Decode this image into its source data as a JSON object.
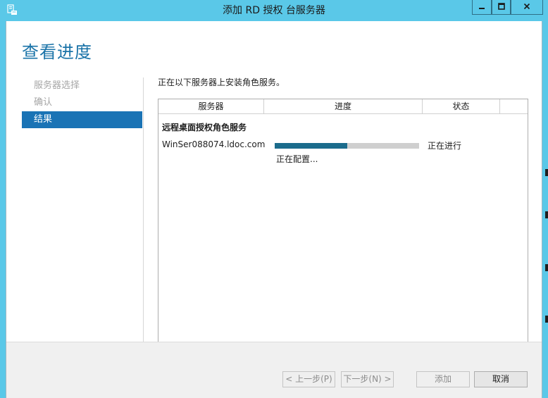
{
  "window": {
    "title": "添加 RD 授权 台服务器",
    "minimize_icon": "minimize-icon",
    "maximize_icon": "maximize-icon",
    "close_icon": "close-icon"
  },
  "page": {
    "heading": "查看进度"
  },
  "nav": {
    "items": [
      {
        "label": "服务器选择",
        "state": "inactive"
      },
      {
        "label": "确认",
        "state": "inactive"
      },
      {
        "label": "结果",
        "state": "active"
      }
    ]
  },
  "main": {
    "intro": "正在以下服务器上安装角色服务。",
    "table": {
      "headers": [
        "服务器",
        "进度",
        "状态"
      ],
      "group_title": "远程桌面授权角色服务",
      "rows": [
        {
          "server": "WinSer088074.ldoc.com",
          "progress_fraction": 0.5,
          "status": "正在进行",
          "detail": "正在配置..."
        }
      ]
    }
  },
  "footer": {
    "prev_label": "< 上一步(P)",
    "next_label": "下一步(N) >",
    "add_label": "添加",
    "cancel_label": "取消"
  },
  "colors": {
    "title_bar": "#5ac8e8",
    "accent": "#1a73b5",
    "progress_fill": "#1b6c8c",
    "progress_track": "#cfcfcf"
  }
}
